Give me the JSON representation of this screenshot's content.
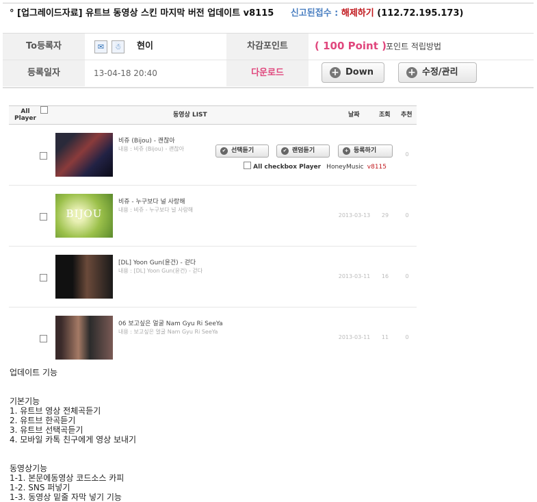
{
  "post": {
    "title": "° [업그레이드자료] 유트브 동영상 스킨 마지막 버전 업데이트 v8115",
    "report_label": "신고된접수 :",
    "release_label": "해제하기",
    "ip": "(112.72.195.173)"
  },
  "info": {
    "registrant_label": "To등록자",
    "registrant_name": "현이",
    "deduct_points_label": "차감포인트",
    "points_value": "( 100 Point )",
    "points_link": "포인트 적립방법",
    "reg_date_label": "등록일자",
    "reg_date_value": "13-04-18 20:40",
    "download_label": "다운로드",
    "down_button": "Down",
    "edit_button": "수정/관리",
    "mail_icon": "✉",
    "user_icon": "☃"
  },
  "player": {
    "header": {
      "all_player": "All Player",
      "list_title": "동영상  LIST",
      "date": "날짜",
      "views": "조회",
      "recommend": "추천"
    },
    "buttons": {
      "select_play": "선택듣기",
      "random_play": "랜덤듣기",
      "register": "등록하기"
    },
    "all_checkbox": "All checkbox Player",
    "honeymusic": "HoneyMusic",
    "version": "v8115",
    "rows": [
      {
        "title": "비쥬 (Bijou) - 괜찮아",
        "subtitle": "내용 : 비쥬 (Bijou) - 괜찮아",
        "date": "",
        "views": "",
        "rec": "0"
      },
      {
        "title": "비쥬 - 누구보다 널 사랑해",
        "subtitle": "내용 : 비쥬 - 누구보다 널 사랑해",
        "date": "2013-03-13",
        "views": "29",
        "rec": "0",
        "thumb_text": "BIJOU"
      },
      {
        "title": "[DL] Yoon Gun(윤건) - 걷다",
        "subtitle": "내용 : [DL] Yoon Gun(윤건) - 걷다",
        "date": "2013-03-11",
        "views": "16",
        "rec": "0"
      },
      {
        "title": "06 보고싶은 얼굴 Nam Gyu Ri SeeYa",
        "subtitle": "내용 : 보고싶은 얼굴 Nam Gyu Ri SeeYa",
        "date": "2013-03-11",
        "views": "11",
        "rec": "0"
      }
    ]
  },
  "description": {
    "heading": "업데이트 기능",
    "basic_title": "기본기능",
    "basic": [
      "1. 유트브 영상 전체곡듣기",
      "2. 유트브 한곡듣기",
      "3. 유트브 선택곡듣기",
      "4. 모바일 카톡 친구에게 영상 보내기"
    ],
    "video_title": "동영상기능",
    "video": [
      "1-1. 본문에동영상  코드소스 카피",
      "1-2. SNS 퍼넣기",
      "1-3. 동영상 밑줄 자막 넣기 기능"
    ]
  }
}
